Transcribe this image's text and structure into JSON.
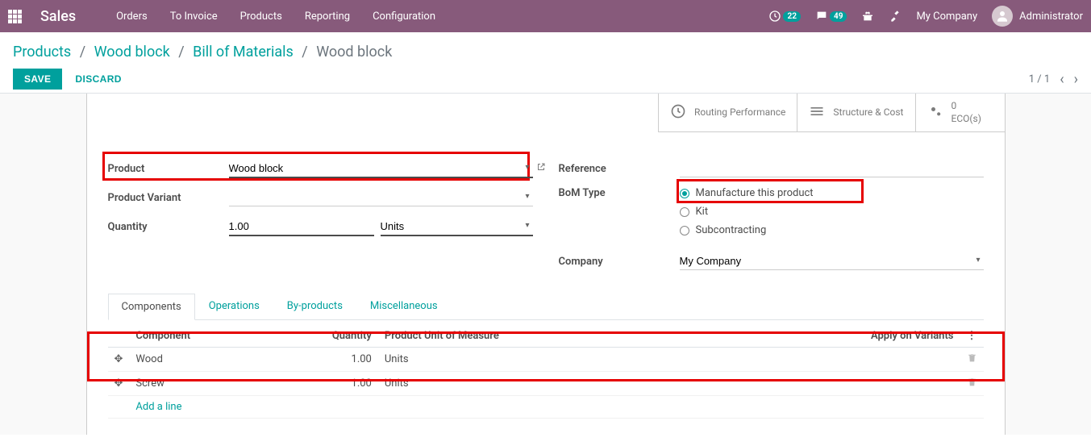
{
  "topnav": {
    "brand": "Sales",
    "items": [
      "Orders",
      "To Invoice",
      "Products",
      "Reporting",
      "Configuration"
    ],
    "activity_count": "22",
    "discuss_count": "49",
    "company": "My Company",
    "user": "Administrator"
  },
  "breadcrumb": {
    "items": [
      "Products",
      "Wood block",
      "Bill of Materials"
    ],
    "current": "Wood block"
  },
  "actions": {
    "save": "SAVE",
    "discard": "DISCARD",
    "pager": "1 / 1"
  },
  "stat": {
    "routing": "Routing Performance",
    "structure": "Structure & Cost",
    "eco_count": "0",
    "eco_label": "ECO(s)"
  },
  "form": {
    "product_label": "Product",
    "product_value": "Wood block",
    "variant_label": "Product Variant",
    "variant_value": "",
    "qty_label": "Quantity",
    "qty_value": "1.00",
    "qty_uom": "Units",
    "reference_label": "Reference",
    "reference_value": "",
    "bom_type_label": "BoM Type",
    "bom_options": {
      "manufacture": "Manufacture this product",
      "kit": "Kit",
      "sub": "Subcontracting"
    },
    "company_label": "Company",
    "company_value": "My Company"
  },
  "notebook": {
    "tabs": [
      "Components",
      "Operations",
      "By-products",
      "Miscellaneous"
    ],
    "columns": {
      "component": "Component",
      "qty": "Quantity",
      "uom": "Product Unit of Measure",
      "variants": "Apply on Variants"
    },
    "rows": [
      {
        "name": "Wood",
        "qty": "1.00",
        "uom": "Units"
      },
      {
        "name": "Screw",
        "qty": "1.00",
        "uom": "Units"
      }
    ],
    "add_line": "Add a line"
  }
}
